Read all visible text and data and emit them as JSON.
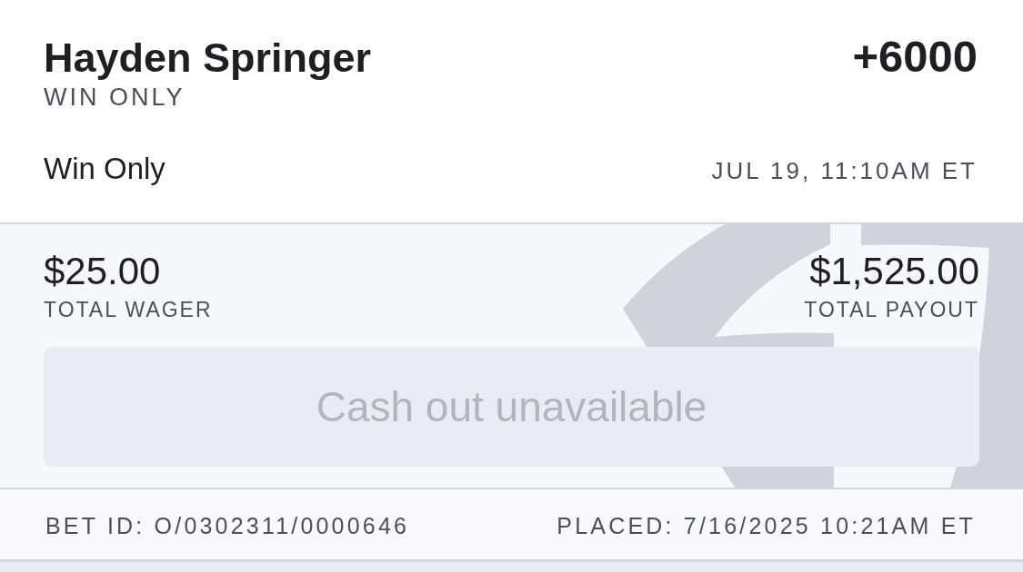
{
  "bet": {
    "selection": "Hayden Springer",
    "odds": "+6000",
    "bet_type": "WIN ONLY",
    "market": "Win Only",
    "event_time": "JUL 19, 11:10AM ET"
  },
  "totals": [
    {
      "amount": "$25.00",
      "label": "TOTAL WAGER"
    },
    {
      "amount": "$1,525.00",
      "label": "TOTAL PAYOUT"
    }
  ],
  "cash_out": {
    "label": "Cash out unavailable",
    "disabled": true
  },
  "footer": {
    "bet_id": "BET ID: O/0302311/0000646",
    "placed": "PLACED: 7/16/2025 10:21AM ET"
  }
}
